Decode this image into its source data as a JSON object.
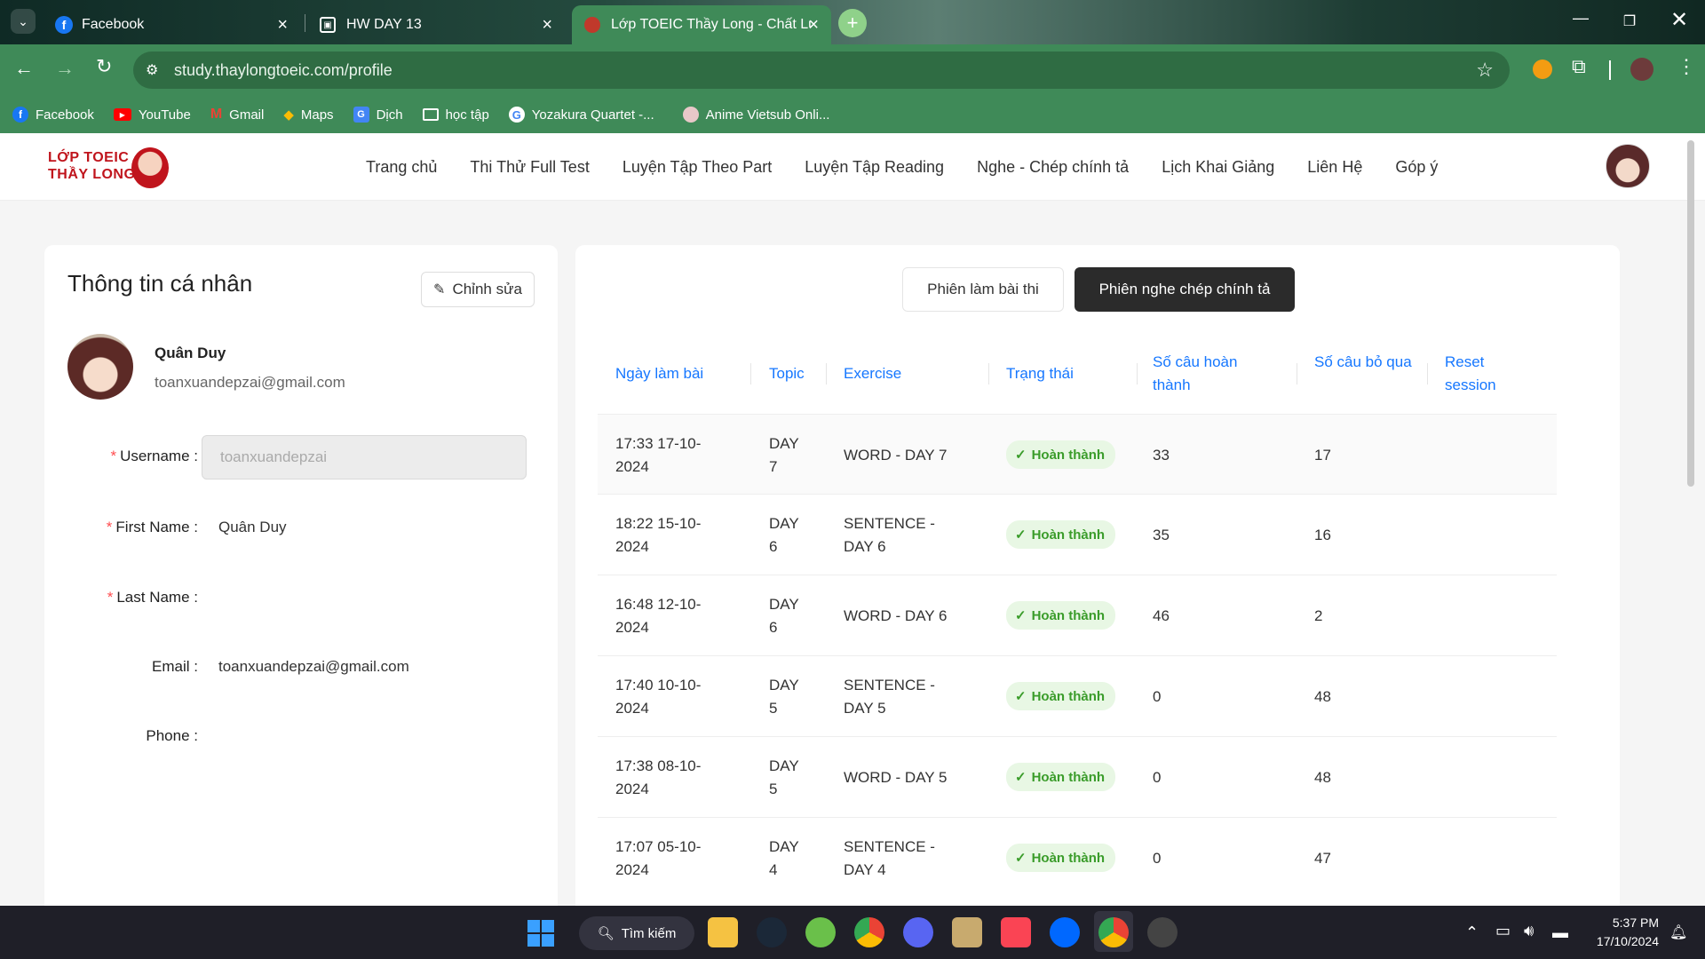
{
  "browser": {
    "tabs": [
      {
        "title": "Facebook"
      },
      {
        "title": "HW DAY 13"
      },
      {
        "title": "Lớp TOEIC Thầy Long - Chất Lượ"
      }
    ],
    "url": "study.thaylongtoeic.com/profile",
    "bookmarks": [
      "Facebook",
      "YouTube",
      "Gmail",
      "Maps",
      "Dịch",
      "học tập",
      "Yozakura Quartet -...",
      "Anime Vietsub Onli..."
    ]
  },
  "site": {
    "logo_line1": "LỚP TOEIC",
    "logo_line2": "THẦY LONG",
    "nav": [
      "Trang chủ",
      "Thi Thử Full Test",
      "Luyện Tập Theo Part",
      "Luyện Tập Reading",
      "Nghe - Chép chính tả",
      "Lịch Khai Giảng",
      "Liên Hệ",
      "Góp ý"
    ]
  },
  "profile": {
    "heading": "Thông tin cá nhân",
    "edit_label": "Chỉnh sửa",
    "display_name": "Quân Duy",
    "email_line": "toanxuandepzai@gmail.com",
    "fields": {
      "username_label": "Username",
      "username_value": "toanxuandepzai",
      "first_name_label": "First Name",
      "first_name_value": "Quân Duy",
      "last_name_label": "Last Name",
      "last_name_value": "",
      "email_label": "Email",
      "email_value": "toanxuandepzai@gmail.com",
      "phone_label": "Phone",
      "phone_value": ""
    }
  },
  "sessions": {
    "tab_exam": "Phiên làm bài thi",
    "tab_dictation": "Phiên nghe chép chính tả",
    "columns": [
      "Ngày làm bài",
      "Topic",
      "Exercise",
      "Trạng thái",
      "Số câu hoàn thành",
      "Số câu bỏ qua",
      "Reset session"
    ],
    "rows": [
      {
        "date": "17:33 17-10-2024",
        "topic": "DAY 7",
        "exercise": "WORD - DAY 7",
        "status": "Hoàn thành",
        "done": "33",
        "skipped": "17"
      },
      {
        "date": "18:22 15-10-2024",
        "topic": "DAY 6",
        "exercise": "SENTENCE - DAY 6",
        "status": "Hoàn thành",
        "done": "35",
        "skipped": "16"
      },
      {
        "date": "16:48 12-10-2024",
        "topic": "DAY 6",
        "exercise": "WORD - DAY 6",
        "status": "Hoàn thành",
        "done": "46",
        "skipped": "2"
      },
      {
        "date": "17:40 10-10-2024",
        "topic": "DAY 5",
        "exercise": "SENTENCE - DAY 5",
        "status": "Hoàn thành",
        "done": "0",
        "skipped": "48"
      },
      {
        "date": "17:38 08-10-2024",
        "topic": "DAY 5",
        "exercise": "WORD - DAY 5",
        "status": "Hoàn thành",
        "done": "0",
        "skipped": "48"
      },
      {
        "date": "17:07 05-10-2024",
        "topic": "DAY 4",
        "exercise": "SENTENCE - DAY 4",
        "status": "Hoàn thành",
        "done": "0",
        "skipped": "47"
      }
    ]
  },
  "taskbar": {
    "search_label": "Tìm kiếm",
    "time": "5:37 PM",
    "date": "17/10/2024"
  }
}
